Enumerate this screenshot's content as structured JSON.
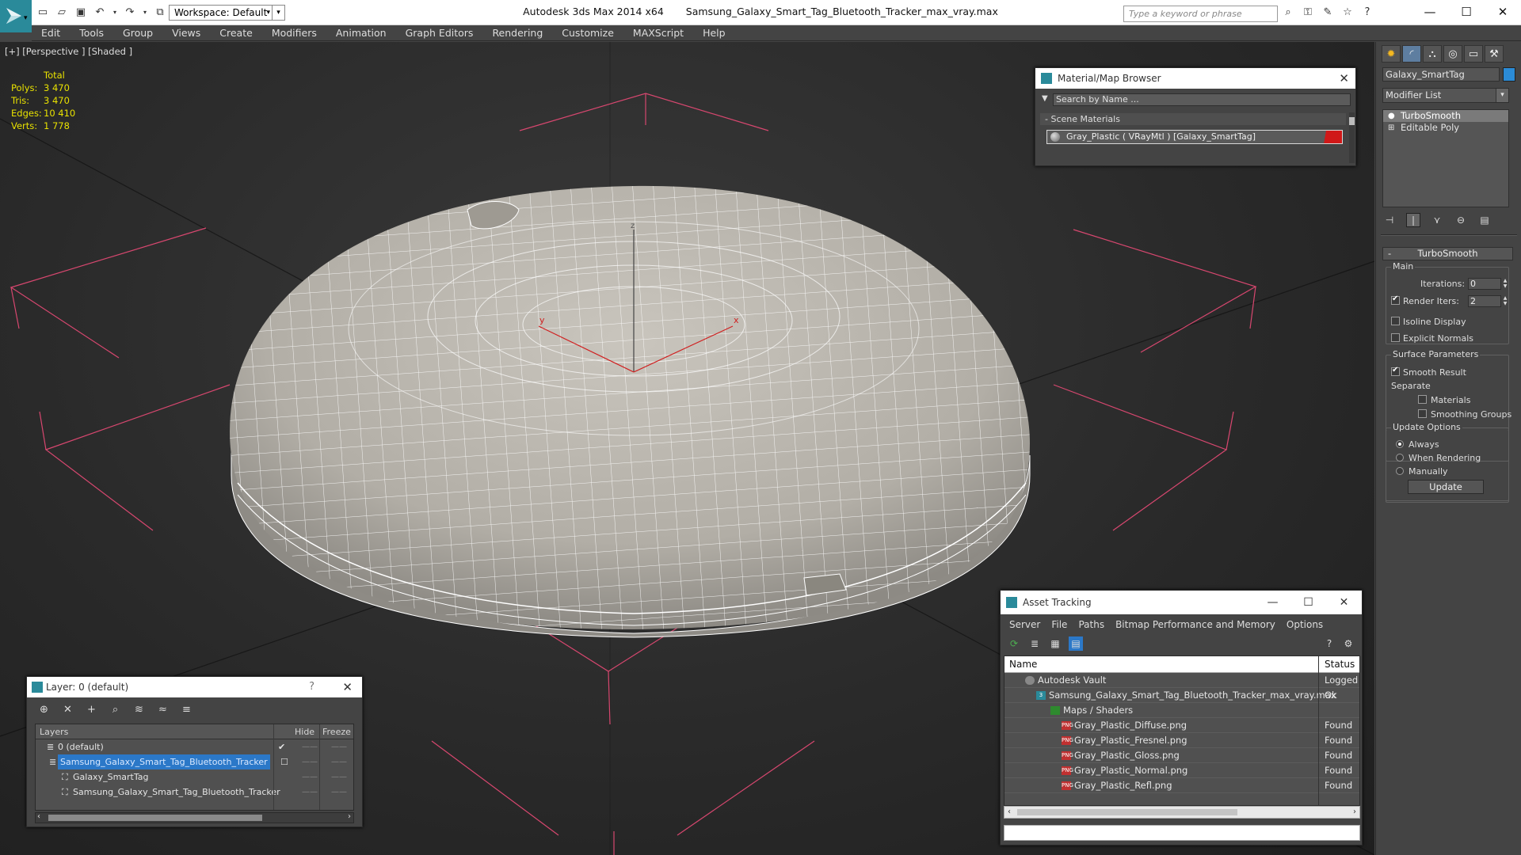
{
  "titlebar": {
    "app_name": "Autodesk 3ds Max  2014 x64",
    "file_name": "Samsung_Galaxy_Smart_Tag_Bluetooth_Tracker_max_vray.max",
    "workspace": "Workspace: Default",
    "search_placeholder": "Type a keyword or phrase"
  },
  "menu": [
    "Edit",
    "Tools",
    "Group",
    "Views",
    "Create",
    "Modifiers",
    "Animation",
    "Graph Editors",
    "Rendering",
    "Customize",
    "MAXScript",
    "Help"
  ],
  "viewport": {
    "label": "[+] [Perspective ] [Shaded ]",
    "stats": {
      "header": "Total",
      "rows": [
        {
          "k": "Polys:",
          "v": "3 470"
        },
        {
          "k": "Tris:",
          "v": "3 470"
        },
        {
          "k": "Edges:",
          "v": "10 410"
        },
        {
          "k": "Verts:",
          "v": "1 778"
        }
      ]
    },
    "axis_labels": {
      "x": "x",
      "y": "y",
      "z": "z"
    }
  },
  "command_panel": {
    "object_name": "Galaxy_SmartTag",
    "object_color": "#2b8bd6",
    "modifier_list": "Modifier List",
    "stack": [
      {
        "label": "TurboSmooth",
        "icon": "light-bulb-icon",
        "selected": true
      },
      {
        "label": "Editable Poly",
        "icon": "plus-box-icon",
        "selected": false
      }
    ],
    "rollout": {
      "title": "TurboSmooth",
      "main_group": "Main",
      "iterations_label": "Iterations:",
      "iterations_value": "0",
      "render_iters_label": "Render Iters:",
      "render_iters_value": "2",
      "render_iters_checked": true,
      "isoline_display": "Isoline Display",
      "explicit_normals": "Explicit Normals",
      "surface_group": "Surface Parameters",
      "smooth_result": "Smooth Result",
      "separate": "Separate",
      "materials": "Materials",
      "smoothing_groups": "Smoothing Groups",
      "update_group": "Update Options",
      "always": "Always",
      "when_rendering": "When Rendering",
      "manually": "Manually",
      "update_button": "Update"
    }
  },
  "material_browser": {
    "title": "Material/Map Browser",
    "search_placeholder": "Search by Name ...",
    "section": "Scene Materials",
    "item": "Gray_Plastic  ( VRayMtl )  [Galaxy_SmartTag]"
  },
  "layer_dialog": {
    "title": "Layer: 0 (default)",
    "help": "?",
    "columns": {
      "layers": "Layers",
      "hide": "Hide",
      "freeze": "Freeze"
    },
    "rows": [
      {
        "name": "0 (default)",
        "indent": 1,
        "selected": false,
        "check": "✔"
      },
      {
        "name": "Samsung_Galaxy_Smart_Tag_Bluetooth_Tracker",
        "indent": 1,
        "selected": true,
        "check": "☐"
      },
      {
        "name": "Galaxy_SmartTag",
        "indent": 2,
        "selected": false,
        "check": ""
      },
      {
        "name": "Samsung_Galaxy_Smart_Tag_Bluetooth_Tracker",
        "indent": 2,
        "selected": false,
        "check": ""
      }
    ]
  },
  "asset_tracking": {
    "title": "Asset Tracking",
    "menu": [
      "Server",
      "File",
      "Paths",
      "Bitmap Performance and Memory",
      "Options"
    ],
    "columns": {
      "name": "Name",
      "status": "Status"
    },
    "rows": [
      {
        "name": "Autodesk Vault",
        "status": "Logged Out",
        "indent": 1,
        "icon": "vault-icon"
      },
      {
        "name": "Samsung_Galaxy_Smart_Tag_Bluetooth_Tracker_max_vray.max",
        "status": "Ok",
        "indent": 2,
        "icon": "max-file-icon"
      },
      {
        "name": "Maps / Shaders",
        "status": "",
        "indent": 3,
        "icon": "maps-icon"
      },
      {
        "name": "Gray_Plastic_Diffuse.png",
        "status": "Found",
        "indent": 4,
        "icon": "png-icon"
      },
      {
        "name": "Gray_Plastic_Fresnel.png",
        "status": "Found",
        "indent": 4,
        "icon": "png-icon"
      },
      {
        "name": "Gray_Plastic_Gloss.png",
        "status": "Found",
        "indent": 4,
        "icon": "png-icon"
      },
      {
        "name": "Gray_Plastic_Normal.png",
        "status": "Found",
        "indent": 4,
        "icon": "png-icon"
      },
      {
        "name": "Gray_Plastic_Refl.png",
        "status": "Found",
        "indent": 4,
        "icon": "png-icon"
      }
    ]
  }
}
